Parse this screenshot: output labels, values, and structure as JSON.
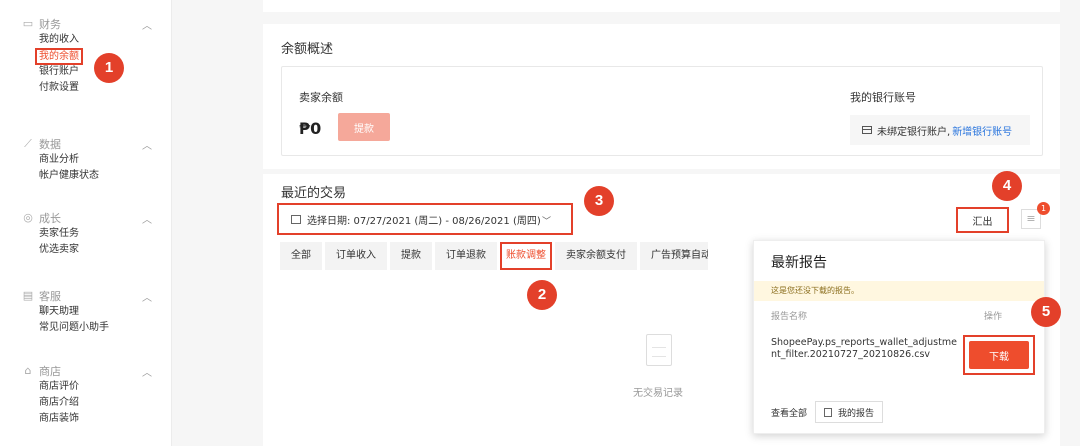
{
  "sidebar": {
    "groups": [
      {
        "icon": "wallet-icon",
        "label": "财务",
        "items": [
          "我的收入",
          "我的余额",
          "银行账户",
          "付款设置"
        ]
      },
      {
        "icon": "chart-icon",
        "label": "数据",
        "items": [
          "商业分析",
          "帐户健康状态"
        ]
      },
      {
        "icon": "growth-icon",
        "label": "成长",
        "items": [
          "卖家任务",
          "优选卖家"
        ]
      },
      {
        "icon": "chat-icon",
        "label": "客服",
        "items": [
          "聊天助理",
          "常见问题小助手"
        ]
      },
      {
        "icon": "shop-icon",
        "label": "商店",
        "items": [
          "商店评价",
          "商店介绍",
          "商店装饰"
        ]
      }
    ],
    "active_item": "我的余额"
  },
  "balance": {
    "title": "余额概述",
    "seller_label": "卖家余额",
    "amount": "₱0",
    "withdraw_label": "提款",
    "bank_label": "我的银行账号",
    "bank_status": "未绑定银行账户,",
    "add_bank_link": "新增银行账号"
  },
  "transactions": {
    "title": "最近的交易",
    "date_label": "选择日期: 07/27/2021 (周二) - 08/26/2021 (周四)",
    "export_label": "汇出",
    "notification_count": "1",
    "tabs": [
      "全部",
      "订单收入",
      "提款",
      "订单退款",
      "账款调整",
      "卖家余额支付",
      "广告预算自动充值"
    ],
    "active_tab": "账款调整",
    "empty_text": "无交易记录"
  },
  "reports": {
    "title": "最新报告",
    "notice": "这是您还没下载的报告。",
    "col_name": "报告名称",
    "col_action": "操作",
    "file_name": "ShopeePay.ps_reports_wallet_adjustment_filter.20210727_20210826.csv",
    "download_label": "下载",
    "view_all": "查看全部",
    "my_reports": "我的报告"
  },
  "steps": [
    "1",
    "2",
    "3",
    "4",
    "5"
  ],
  "colors": {
    "accent": "#ee4d2d",
    "highlight": "#e3402a",
    "link": "#2673dd"
  }
}
